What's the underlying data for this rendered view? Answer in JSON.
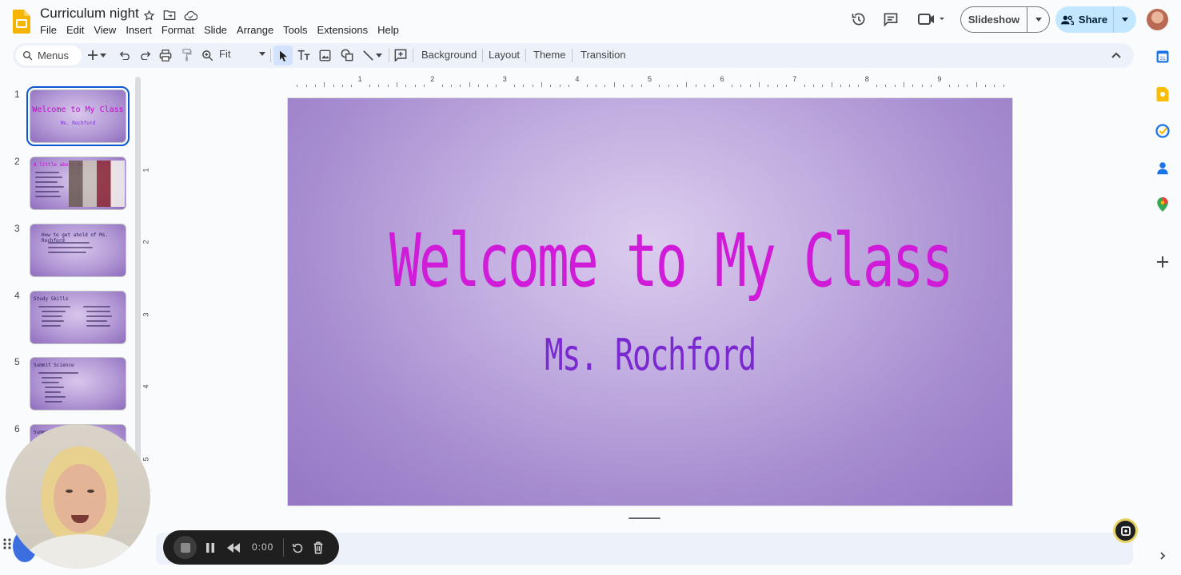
{
  "document": {
    "title": "Curriculum night"
  },
  "menubar": [
    "File",
    "Edit",
    "View",
    "Insert",
    "Format",
    "Slide",
    "Arrange",
    "Tools",
    "Extensions",
    "Help"
  ],
  "header": {
    "slideshow_label": "Slideshow",
    "share_label": "Share"
  },
  "toolbar": {
    "menus_placeholder": "Menus",
    "zoom_value": "Fit",
    "background_label": "Background",
    "layout_label": "Layout",
    "theme_label": "Theme",
    "transition_label": "Transition"
  },
  "ruler": {
    "horizontal": [
      "1",
      "2",
      "3",
      "4",
      "5",
      "6",
      "7",
      "8",
      "9"
    ],
    "vertical": [
      "1",
      "2",
      "3",
      "4",
      "5"
    ]
  },
  "filmstrip": {
    "slides": [
      {
        "number": "1",
        "title": "Welcome to My Class",
        "subtitle": "Ms. Rochford"
      },
      {
        "number": "2",
        "title": "A little about Me..."
      },
      {
        "number": "3",
        "title": "How to get ahold of Ms. Rochford"
      },
      {
        "number": "4",
        "title": "Study Skills"
      },
      {
        "number": "5",
        "title": "Summit Science"
      },
      {
        "number": "6",
        "title": "Summit"
      }
    ]
  },
  "slide": {
    "title": "Welcome to My Class",
    "subtitle": "Ms. Rochford"
  },
  "recorder": {
    "time": "0:00"
  },
  "colors": {
    "accent": "#0b57d0",
    "share_bg": "#c2e7ff",
    "title_magenta": "#d01bd8",
    "subtitle_purple": "#7a28d0"
  }
}
